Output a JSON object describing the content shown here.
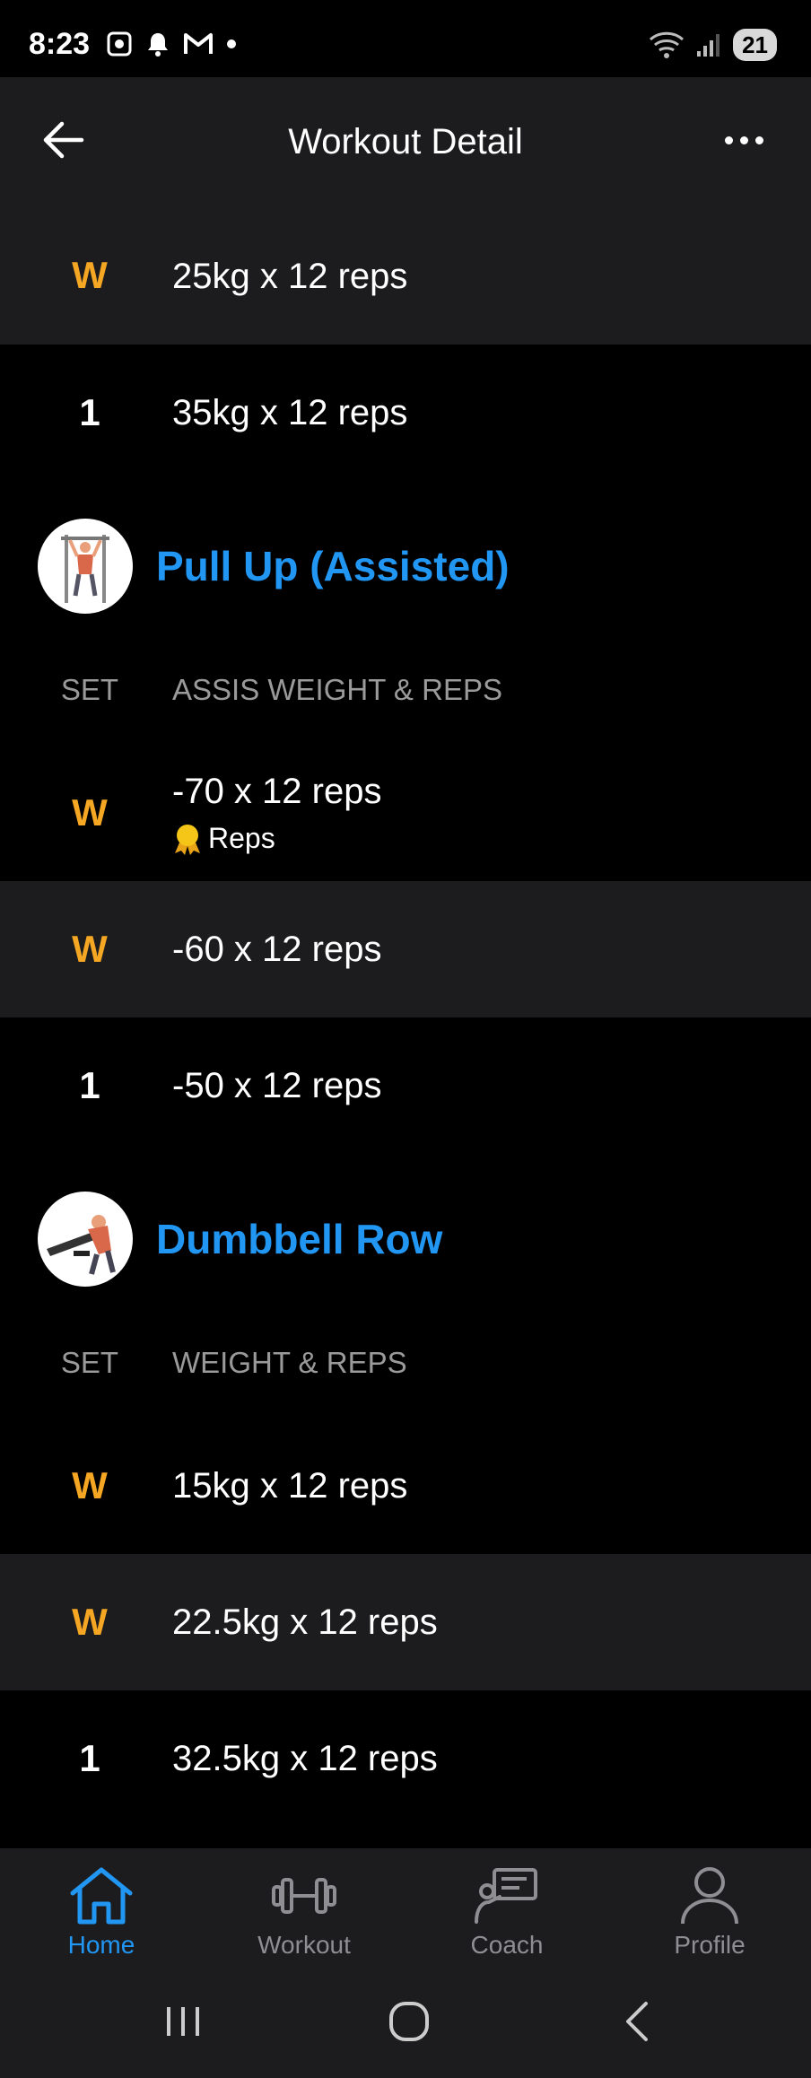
{
  "status_bar": {
    "time": "8:23",
    "battery": "21"
  },
  "header": {
    "title": "Workout Detail"
  },
  "first_exercise_sets": [
    {
      "set": "W",
      "value": "25kg x 12 reps"
    },
    {
      "set": "1",
      "value": "35kg x 12 reps"
    }
  ],
  "exercises": [
    {
      "name": "Pull Up (Assisted)",
      "col_set": "SET",
      "col_value": "ASSIS WEIGHT & REPS",
      "sets": [
        {
          "set": "W",
          "value": "-70 x 12 reps",
          "badge": "Reps"
        },
        {
          "set": "W",
          "value": "-60 x 12 reps"
        },
        {
          "set": "1",
          "value": "-50 x 12 reps"
        }
      ]
    },
    {
      "name": "Dumbbell Row",
      "col_set": "SET",
      "col_value": "WEIGHT & REPS",
      "sets": [
        {
          "set": "W",
          "value": "15kg x 12 reps"
        },
        {
          "set": "W",
          "value": "22.5kg x 12 reps"
        },
        {
          "set": "1",
          "value": "32.5kg x 12 reps"
        }
      ]
    }
  ],
  "bottom_nav": [
    {
      "label": "Home",
      "icon": "home-icon",
      "active": true
    },
    {
      "label": "Workout",
      "icon": "dumbbell-icon",
      "active": false
    },
    {
      "label": "Coach",
      "icon": "coach-icon",
      "active": false
    },
    {
      "label": "Profile",
      "icon": "profile-icon",
      "active": false
    }
  ],
  "colors": {
    "accent": "#2196f3",
    "warmup": "#f5a623",
    "row_alt": "#1c1c1e",
    "background": "#000000"
  }
}
